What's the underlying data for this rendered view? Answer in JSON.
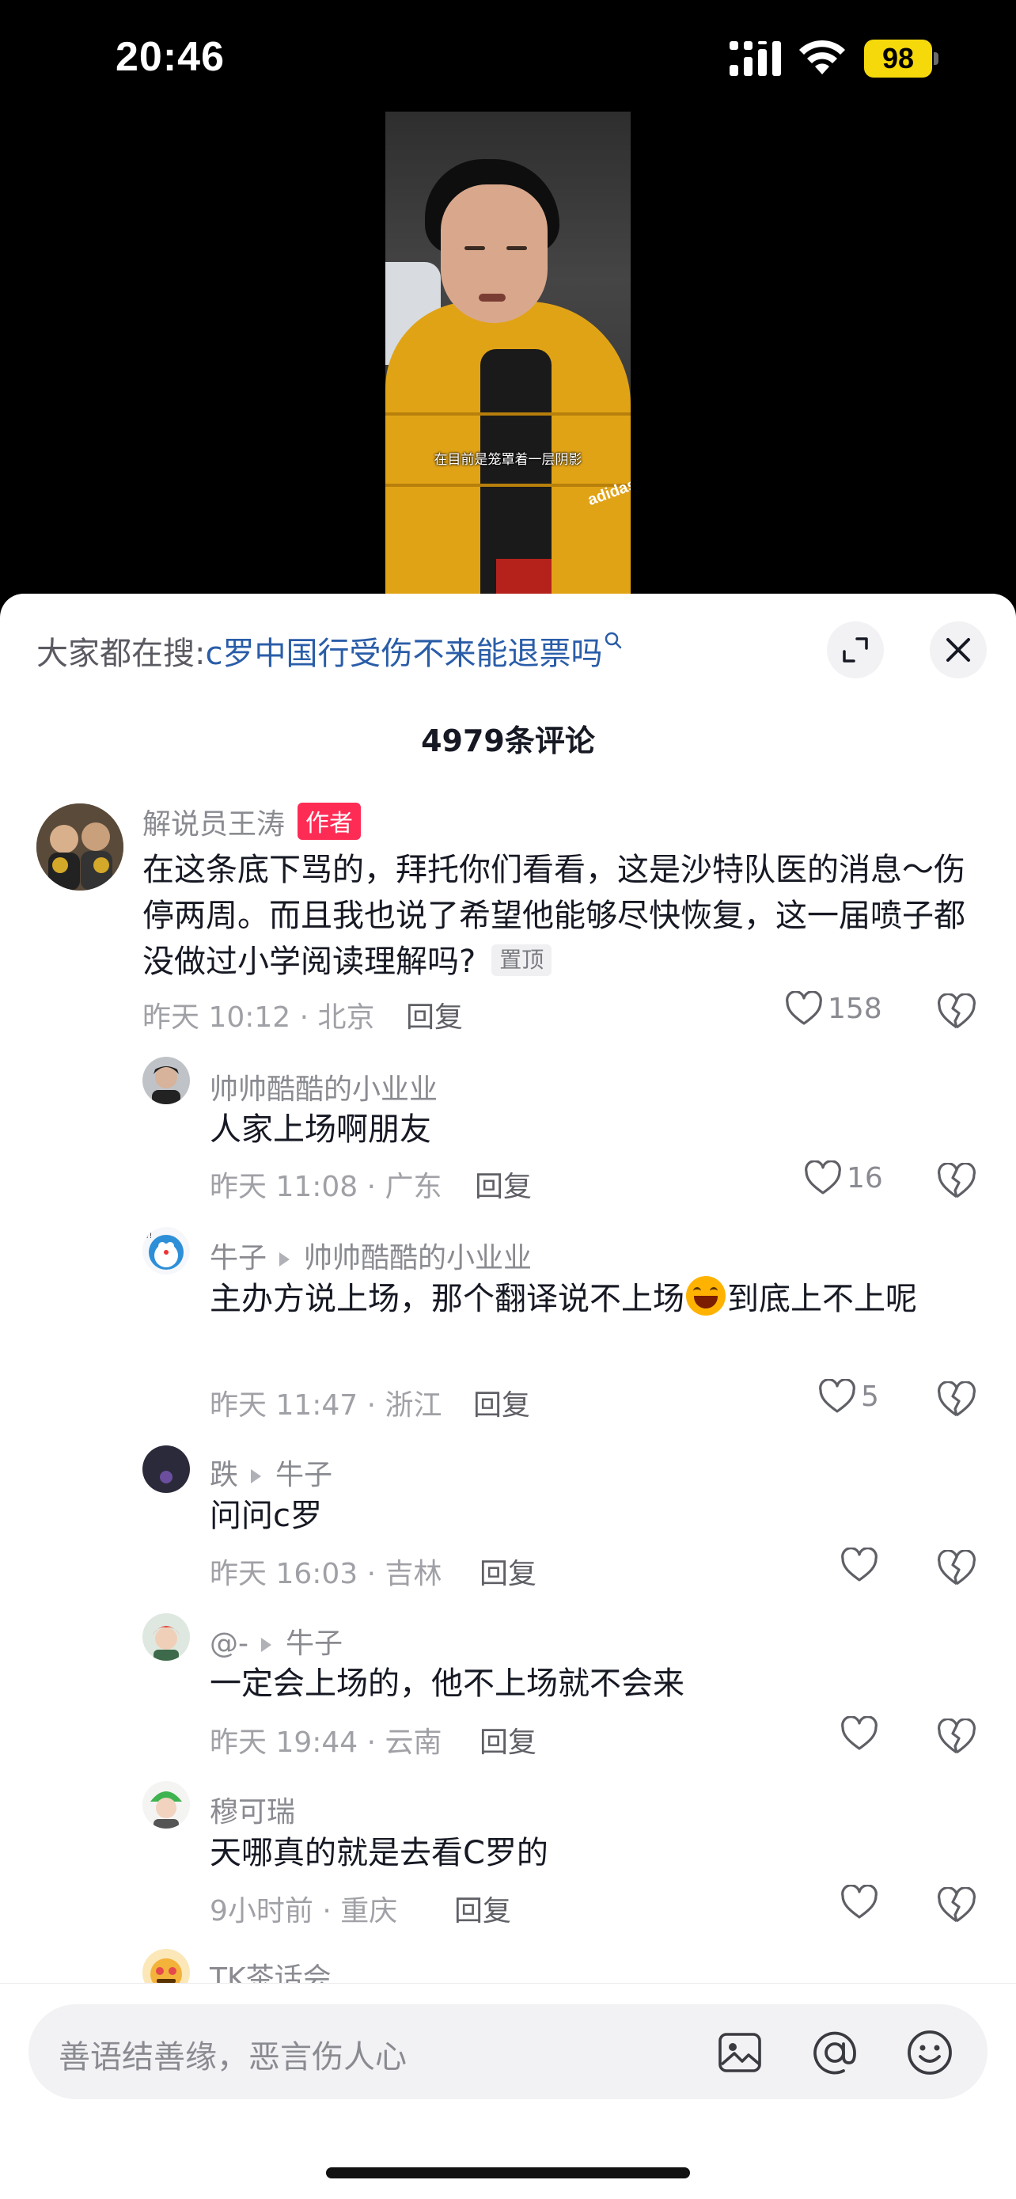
{
  "status_bar": {
    "time": "20:46",
    "battery": "98"
  },
  "video": {
    "subtitle": "在目前是笼罩着一层阴影",
    "brand": "adidas"
  },
  "sheet": {
    "search_prefix": "大家都在搜:",
    "search_query": "c罗中国行受伤不来能退票吗",
    "comment_count": "4979条评论"
  },
  "comments": [
    {
      "name": "解说员王涛",
      "badge": "作者",
      "text": "在这条底下骂的，拜托你们看看，这是沙特队医的消息～伤停两周。而且我也说了希望他能够尽快恢复，这一届喷子都没做过小学阅读理解吗?",
      "pin": "置顶",
      "meta": "昨天 10:12 · 北京",
      "reply": "回复",
      "likes": "158"
    },
    {
      "name": "帅帅酷酷的小业业",
      "text": "人家上场啊朋友",
      "meta": "昨天 11:08 · 广东",
      "reply": "回复",
      "likes": "16"
    },
    {
      "name": "牛子",
      "reply_to": "帅帅酷酷的小业业",
      "text_before": "主办方说上场，那个翻译说不上场",
      "emoji": "laughing-face",
      "text_after": "到底上不上呢",
      "meta": "昨天 11:47 · 浙江",
      "reply": "回复",
      "likes": "5"
    },
    {
      "name": "跌",
      "reply_to": "牛子",
      "text": "问问c罗",
      "meta": "昨天 16:03 · 吉林",
      "reply": "回复",
      "likes": ""
    },
    {
      "name": "@-",
      "reply_to": "牛子",
      "text": "一定会上场的，他不上场就不会来",
      "meta": "昨天 19:44 · 云南",
      "reply": "回复",
      "likes": ""
    },
    {
      "name": "穆可瑞",
      "text": "天哪真的就是去看C罗的",
      "meta": "9小时前 · 重庆",
      "reply": "回复",
      "likes": ""
    },
    {
      "name": "TK茶话会"
    }
  ],
  "input": {
    "placeholder": "善语结善缘，恶言伤人心"
  },
  "icons": {
    "expand": "expand-icon",
    "close": "close-icon",
    "like": "heart-icon",
    "dislike": "broken-heart-icon",
    "image": "image-icon",
    "mention": "at-icon",
    "emoji": "emoji-icon"
  },
  "colors": {
    "accent": "#fe2c55",
    "link": "#2a5da8",
    "battery": "#f5d90a"
  }
}
